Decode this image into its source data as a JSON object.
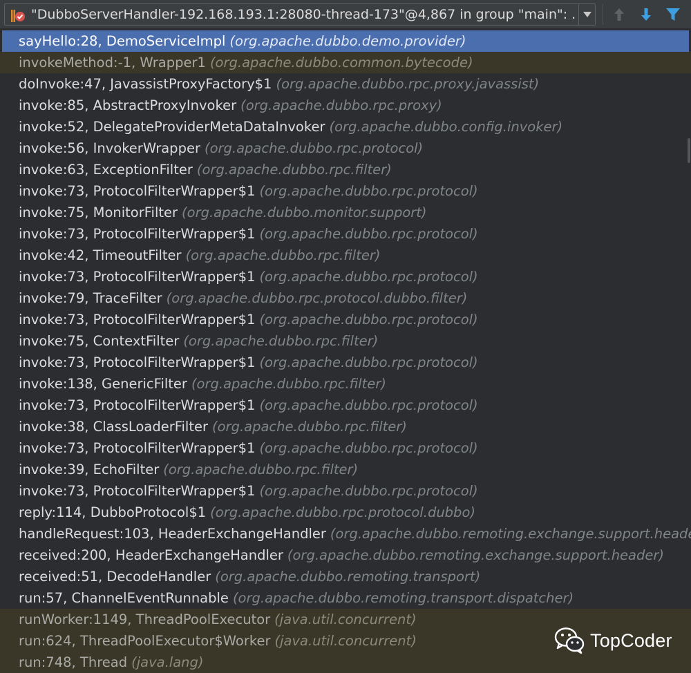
{
  "thread_selector": {
    "title": "\"DubboServerHandler-192.168.193.1:28080-thread-173\"@4,867 in group \"main\": ...",
    "icon": "thread-suspended-icon",
    "dropdown_icon": "triangle-down-icon"
  },
  "toolbar": {
    "up_icon": "arrow-up-icon",
    "down_icon": "arrow-down-icon",
    "filter_icon": "filter-funnel-icon"
  },
  "frames": [
    {
      "method": "sayHello:28, DemoServiceImpl",
      "package": "(org.apache.dubbo.demo.provider)",
      "state": "selected"
    },
    {
      "method": "invokeMethod:-1, Wrapper1",
      "package": "(org.apache.dubbo.common.bytecode)",
      "state": "library"
    },
    {
      "method": "doInvoke:47, JavassistProxyFactory$1",
      "package": "(org.apache.dubbo.rpc.proxy.javassist)",
      "state": "normal"
    },
    {
      "method": "invoke:85, AbstractProxyInvoker",
      "package": "(org.apache.dubbo.rpc.proxy)",
      "state": "normal"
    },
    {
      "method": "invoke:52, DelegateProviderMetaDataInvoker",
      "package": "(org.apache.dubbo.config.invoker)",
      "state": "normal"
    },
    {
      "method": "invoke:56, InvokerWrapper",
      "package": "(org.apache.dubbo.rpc.protocol)",
      "state": "normal"
    },
    {
      "method": "invoke:63, ExceptionFilter",
      "package": "(org.apache.dubbo.rpc.filter)",
      "state": "normal"
    },
    {
      "method": "invoke:73, ProtocolFilterWrapper$1",
      "package": "(org.apache.dubbo.rpc.protocol)",
      "state": "normal"
    },
    {
      "method": "invoke:75, MonitorFilter",
      "package": "(org.apache.dubbo.monitor.support)",
      "state": "normal"
    },
    {
      "method": "invoke:73, ProtocolFilterWrapper$1",
      "package": "(org.apache.dubbo.rpc.protocol)",
      "state": "normal"
    },
    {
      "method": "invoke:42, TimeoutFilter",
      "package": "(org.apache.dubbo.rpc.filter)",
      "state": "normal"
    },
    {
      "method": "invoke:73, ProtocolFilterWrapper$1",
      "package": "(org.apache.dubbo.rpc.protocol)",
      "state": "normal"
    },
    {
      "method": "invoke:79, TraceFilter",
      "package": "(org.apache.dubbo.rpc.protocol.dubbo.filter)",
      "state": "normal"
    },
    {
      "method": "invoke:73, ProtocolFilterWrapper$1",
      "package": "(org.apache.dubbo.rpc.protocol)",
      "state": "normal"
    },
    {
      "method": "invoke:75, ContextFilter",
      "package": "(org.apache.dubbo.rpc.filter)",
      "state": "normal"
    },
    {
      "method": "invoke:73, ProtocolFilterWrapper$1",
      "package": "(org.apache.dubbo.rpc.protocol)",
      "state": "normal"
    },
    {
      "method": "invoke:138, GenericFilter",
      "package": "(org.apache.dubbo.rpc.filter)",
      "state": "normal"
    },
    {
      "method": "invoke:73, ProtocolFilterWrapper$1",
      "package": "(org.apache.dubbo.rpc.protocol)",
      "state": "normal"
    },
    {
      "method": "invoke:38, ClassLoaderFilter",
      "package": "(org.apache.dubbo.rpc.filter)",
      "state": "normal"
    },
    {
      "method": "invoke:73, ProtocolFilterWrapper$1",
      "package": "(org.apache.dubbo.rpc.protocol)",
      "state": "normal"
    },
    {
      "method": "invoke:39, EchoFilter",
      "package": "(org.apache.dubbo.rpc.filter)",
      "state": "normal"
    },
    {
      "method": "invoke:73, ProtocolFilterWrapper$1",
      "package": "(org.apache.dubbo.rpc.protocol)",
      "state": "normal"
    },
    {
      "method": "reply:114, DubboProtocol$1",
      "package": "(org.apache.dubbo.rpc.protocol.dubbo)",
      "state": "normal"
    },
    {
      "method": "handleRequest:103, HeaderExchangeHandler",
      "package": "(org.apache.dubbo.remoting.exchange.support.header)",
      "state": "normal"
    },
    {
      "method": "received:200, HeaderExchangeHandler",
      "package": "(org.apache.dubbo.remoting.exchange.support.header)",
      "state": "normal"
    },
    {
      "method": "received:51, DecodeHandler",
      "package": "(org.apache.dubbo.remoting.transport)",
      "state": "normal"
    },
    {
      "method": "run:57, ChannelEventRunnable",
      "package": "(org.apache.dubbo.remoting.transport.dispatcher)",
      "state": "normal"
    },
    {
      "method": "runWorker:1149, ThreadPoolExecutor",
      "package": "(java.util.concurrent)",
      "state": "library"
    },
    {
      "method": "run:624, ThreadPoolExecutor$Worker",
      "package": "(java.util.concurrent)",
      "state": "library"
    },
    {
      "method": "run:748, Thread",
      "package": "(java.lang)",
      "state": "library"
    }
  ],
  "watermark": {
    "text": "TopCoder",
    "icon": "wechat-logo-icon"
  },
  "colors": {
    "background": "#2b2d30",
    "selected_row": "#4b6eaf",
    "library_row": "#3a3628",
    "arrow_up": "#5f6366",
    "arrow_down": "#3d9fe0",
    "filter": "#3d9fe0"
  }
}
